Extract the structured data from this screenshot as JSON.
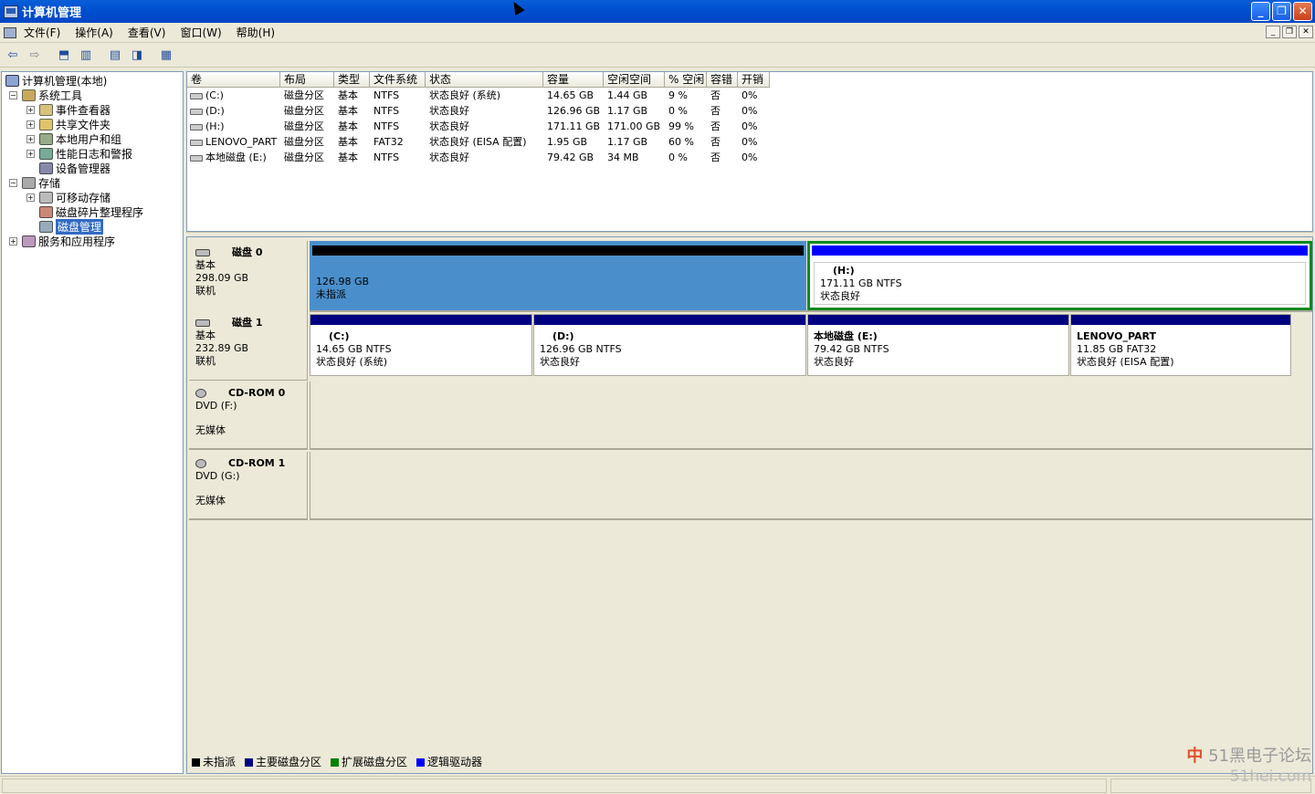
{
  "window": {
    "title": "计算机管理"
  },
  "menu": [
    "文件(F)",
    "操作(A)",
    "查看(V)",
    "窗口(W)",
    "帮助(H)"
  ],
  "tree": {
    "root": "计算机管理(本地)",
    "system_tools": "系统工具",
    "event_viewer": "事件查看器",
    "shared_folders": "共享文件夹",
    "local_users": "本地用户和组",
    "perf_logs": "性能日志和警报",
    "device_manager": "设备管理器",
    "storage": "存储",
    "removable": "可移动存储",
    "defrag": "磁盘碎片整理程序",
    "disk_mgmt": "磁盘管理",
    "services": "服务和应用程序"
  },
  "columns": [
    "卷",
    "布局",
    "类型",
    "文件系统",
    "状态",
    "容量",
    "空闲空间",
    "% 空闲",
    "容错",
    "开销"
  ],
  "volumes": [
    {
      "name": "(C:)",
      "layout": "磁盘分区",
      "type": "基本",
      "fs": "NTFS",
      "status": "状态良好 (系统)",
      "capacity": "14.65 GB",
      "free": "1.44 GB",
      "pct": "9 %",
      "ft": "否",
      "overhead": "0%"
    },
    {
      "name": "(D:)",
      "layout": "磁盘分区",
      "type": "基本",
      "fs": "NTFS",
      "status": "状态良好",
      "capacity": "126.96 GB",
      "free": "1.17 GB",
      "pct": "0 %",
      "ft": "否",
      "overhead": "0%"
    },
    {
      "name": "(H:)",
      "layout": "磁盘分区",
      "type": "基本",
      "fs": "NTFS",
      "status": "状态良好",
      "capacity": "171.11 GB",
      "free": "171.00 GB",
      "pct": "99 %",
      "ft": "否",
      "overhead": "0%"
    },
    {
      "name": "LENOVO_PART",
      "layout": "磁盘分区",
      "type": "基本",
      "fs": "FAT32",
      "status": "状态良好 (EISA 配置)",
      "capacity": "1.95 GB",
      "free": "1.17 GB",
      "pct": "60 %",
      "ft": "否",
      "overhead": "0%"
    },
    {
      "name": "本地磁盘 (E:)",
      "layout": "磁盘分区",
      "type": "基本",
      "fs": "NTFS",
      "status": "状态良好",
      "capacity": "79.42 GB",
      "free": "34 MB",
      "pct": "0 %",
      "ft": "否",
      "overhead": "0%"
    }
  ],
  "disks": [
    {
      "name": "磁盘 0",
      "type": "基本",
      "size": "298.09 GB",
      "state": "联机",
      "parts": [
        {
          "title": "",
          "line1": "126.98 GB",
          "line2": "未指派",
          "color": "#000000"
        },
        {
          "title": "(H:)",
          "line1": "171.11 GB NTFS",
          "line2": "状态良好",
          "color": "#0000ff"
        }
      ]
    },
    {
      "name": "磁盘 1",
      "type": "基本",
      "size": "232.89 GB",
      "state": "联机",
      "parts": [
        {
          "title": "(C:)",
          "line1": "14.65 GB NTFS",
          "line2": "状态良好 (系统)",
          "color": "#000080"
        },
        {
          "title": "(D:)",
          "line1": "126.96 GB NTFS",
          "line2": "状态良好",
          "color": "#000080"
        },
        {
          "title": "本地磁盘  (E:)",
          "line1": "79.42 GB NTFS",
          "line2": "状态良好",
          "color": "#000080"
        },
        {
          "title": "LENOVO_PART",
          "line1": "11.85 GB FAT32",
          "line2": "状态良好 (EISA 配置)",
          "color": "#000080"
        }
      ]
    },
    {
      "name": "CD-ROM 0",
      "type": "DVD (F:)",
      "state": "无媒体"
    },
    {
      "name": "CD-ROM 1",
      "type": "DVD (G:)",
      "state": "无媒体"
    }
  ],
  "legend": [
    {
      "label": "未指派",
      "color": "#000000"
    },
    {
      "label": "主要磁盘分区",
      "color": "#000080"
    },
    {
      "label": "扩展磁盘分区",
      "color": "#008000"
    },
    {
      "label": "逻辑驱动器",
      "color": "#0000ff"
    }
  ],
  "watermark": {
    "text": "51黑电子论坛",
    "site": "51hei.com",
    "ime": "中"
  }
}
